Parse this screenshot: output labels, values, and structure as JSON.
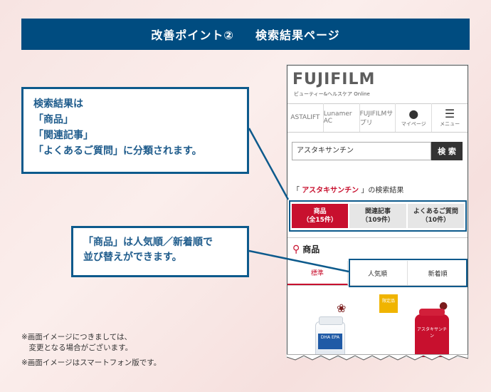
{
  "banner": {
    "part1": "改善ポイント②",
    "part2": "検索結果ページ"
  },
  "callout1": {
    "lines": [
      "検索結果は",
      "「商品」",
      "「関連記事」",
      "「よくあるご質問」に分類されます。"
    ]
  },
  "callout2": {
    "lines": [
      "「商品」は人気順／新着順で",
      "並び替えができます。"
    ]
  },
  "notes": {
    "line1": "※画面イメージにつきましては、",
    "line2": "　変更となる場合がございます。",
    "line3": "※画面イメージはスマートフォン版です。"
  },
  "phone": {
    "logo": "FUJIFILM",
    "logo_sub": "ビューティー&ヘルスケア Online",
    "nav": [
      "ASTALIFT",
      "Lunamer AC",
      "FUJIFILMサプリ",
      "マイページ",
      "メニュー"
    ],
    "search_value": "アスタキサンチン",
    "search_button": "検 索",
    "result_prefix": "「",
    "result_query": "アスタキサンチン",
    "result_suffix": "」の検索結果",
    "tabs": [
      {
        "label": "商品",
        "count": "（全15件）"
      },
      {
        "label": "関連記事",
        "count": "（109件）"
      },
      {
        "label": "よくあるご質問",
        "count": "（10件）"
      }
    ],
    "products_title": "商品",
    "sort": [
      "標準",
      "人気順",
      "新着順"
    ],
    "limited_badge": "限定品",
    "product1_label": "DHA EPA",
    "product2_label": "アスタキサンチン"
  },
  "colors": {
    "navy": "#004c80",
    "accent_red": "#c8102e",
    "frame_blue": "#0d5a8c"
  }
}
